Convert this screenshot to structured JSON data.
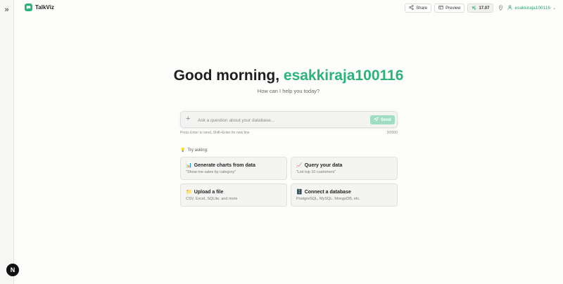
{
  "brand": {
    "name": "TalkViz",
    "logo_icon": "chat-icon",
    "accent": "#2bb37a"
  },
  "sidebar": {
    "toggle_label": "»"
  },
  "header": {
    "share_label": "Share",
    "preview_label": "Preview",
    "credits": "17.07",
    "user": "esakkiraja100116"
  },
  "hero": {
    "greeting": "Good morning, ",
    "name": "esakkiraja100116",
    "subtitle": "How can I help you today?"
  },
  "composer": {
    "placeholder": "Ask a question about your database...",
    "value": "",
    "send_label": "Send",
    "hint": "Press Enter to send, Shift+Enter for new line",
    "count": "0/2000"
  },
  "suggestions": {
    "heading": "Try asking:",
    "heading_icon": "💡",
    "items": [
      {
        "icon": "📊",
        "title": "Generate charts from data",
        "desc": "\"Show me sales by category\""
      },
      {
        "icon": "📈",
        "title": "Query your data",
        "desc": "\"List top 10 customers\""
      },
      {
        "icon": "📁",
        "title": "Upload a file",
        "desc": "CSV, Excel, SQLite, and more"
      },
      {
        "icon": "🗄️",
        "title": "Connect a database",
        "desc": "PostgreSQL, MySQL, MongoDB, etc."
      }
    ]
  },
  "footer_badge": "N"
}
